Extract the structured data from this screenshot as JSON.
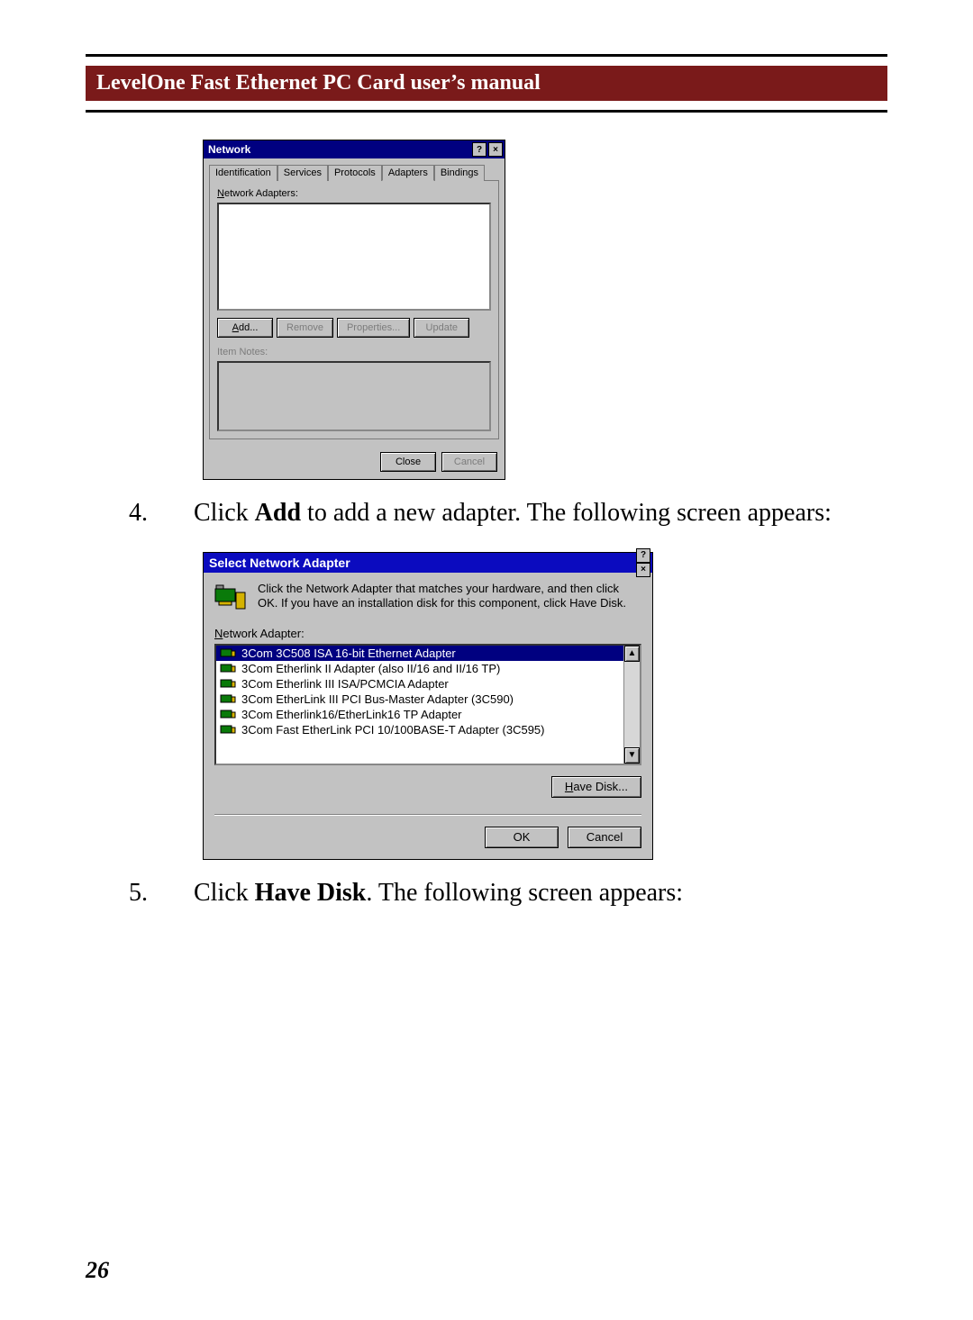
{
  "header": {
    "title": "LevelOne Fast Ethernet PC Card user’s manual"
  },
  "page_number": "26",
  "steps": {
    "s4_num": "4.",
    "s4_a": "Click ",
    "s4_bold": "Add",
    "s4_b": " to add a new adapter.  The following screen appears:",
    "s5_num": "5.",
    "s5_a": "Click ",
    "s5_bold": "Have Disk",
    "s5_b": ".  The following screen appears:"
  },
  "dlg1": {
    "title": "Network",
    "tabs": [
      "Identification",
      "Services",
      "Protocols",
      "Adapters",
      "Bindings"
    ],
    "label_adapters": "Network Adapters:",
    "btn_add": "Add...",
    "btn_remove": "Remove",
    "btn_properties": "Properties...",
    "btn_update": "Update",
    "label_itemnotes": "Item Notes:",
    "btn_close": "Close",
    "btn_cancel": "Cancel"
  },
  "dlg2": {
    "title": "Select Network Adapter",
    "instruction": "Click the Network Adapter that matches your hardware, and then click OK.  If you have an installation disk for this component, click Have Disk.",
    "label_list": "Network Adapter:",
    "items": [
      "3Com 3C508 ISA 16-bit Ethernet Adapter",
      "3Com Etherlink II Adapter (also II/16 and II/16 TP)",
      "3Com Etherlink III ISA/PCMCIA Adapter",
      "3Com EtherLink III PCI Bus-Master Adapter (3C590)",
      "3Com Etherlink16/EtherLink16 TP Adapter",
      "3Com Fast EtherLink PCI 10/100BASE-T Adapter (3C595)"
    ],
    "btn_havedisk": "Have Disk...",
    "btn_ok": "OK",
    "btn_cancel": "Cancel"
  }
}
